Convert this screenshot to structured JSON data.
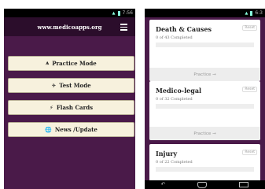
{
  "left_screen": {
    "status": {
      "time": "7:56"
    },
    "appbar": {
      "title": "www.medicoapps.org",
      "menu_icon": "hamburger-icon"
    },
    "buttons": [
      {
        "icon": "road-icon",
        "glyph": "⩚",
        "label": "Practice Mode"
      },
      {
        "icon": "plane-icon",
        "glyph": "✈",
        "label": "Test Mode"
      },
      {
        "icon": "flash-icon",
        "glyph": "⚡",
        "label": "Flash Cards"
      },
      {
        "icon": "globe-icon",
        "glyph": "🌐",
        "label": "News /Update"
      }
    ]
  },
  "right_screen": {
    "status": {
      "time": "6:3"
    },
    "cards": [
      {
        "title": "Death & Causes",
        "reset": "Reset",
        "progress": "0 of 43 Completed",
        "progress_fraction": 0,
        "action": "Practice →"
      },
      {
        "title": "Medico-legal",
        "reset": "Reset",
        "progress": "0 of 32 Completed",
        "progress_fraction": 0,
        "action": "Practice →"
      },
      {
        "title": "Injury",
        "reset": "Reset",
        "progress": "0 of 22 Completed",
        "progress_fraction": 0
      }
    ],
    "nav": {
      "back": "back-icon",
      "home": "home-icon",
      "recent": "recent-apps-icon"
    }
  }
}
